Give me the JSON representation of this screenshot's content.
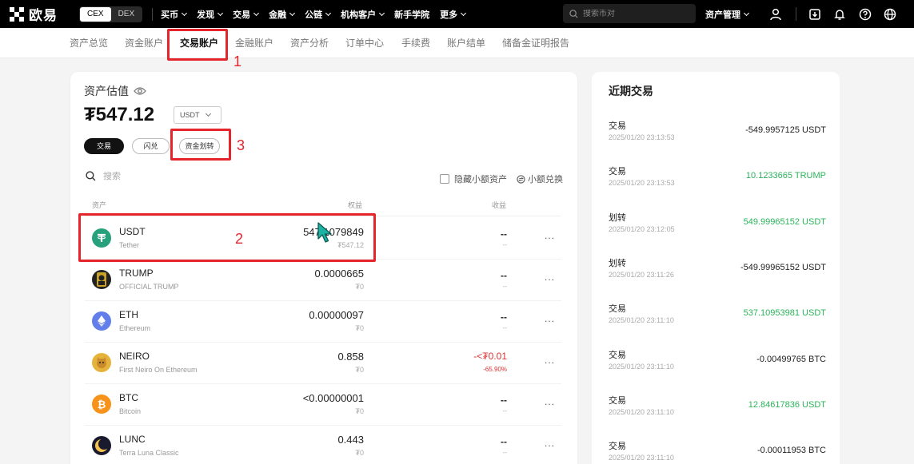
{
  "topbar": {
    "logo_text": "欧易",
    "cex_label": "CEX",
    "dex_label": "DEX",
    "nav": [
      "买币",
      "发现",
      "交易",
      "金融",
      "公链",
      "机构客户",
      "新手学院",
      "更多"
    ],
    "nav_dropdowns": [
      true,
      true,
      true,
      true,
      true,
      true,
      false,
      true
    ],
    "search_placeholder": "搜索币对",
    "asset_mgmt": "资产管理"
  },
  "subnav": {
    "items": [
      "资产总览",
      "资金账户",
      "交易账户",
      "金融账户",
      "资产分析",
      "订单中心",
      "手续费",
      "账户结单",
      "储备金证明报告"
    ],
    "active_index": 2
  },
  "annotations": {
    "n1": "1",
    "n2": "2",
    "n3": "3",
    "color": "#e5242c"
  },
  "account": {
    "est_label": "资产估值",
    "est_value": "₮547.12",
    "currency": "USDT",
    "btn_trade": "交易",
    "btn_flash": "闪兑",
    "btn_transfer": "资金划转",
    "search_placeholder": "搜索",
    "hide_small": "隐藏小额资产",
    "small_convert": "小额兑换",
    "col_asset": "资产",
    "col_equity": "权益",
    "col_pnl": "收益"
  },
  "assets": [
    {
      "symbol": "USDT",
      "name": "Tether",
      "qty": "547.1079849",
      "value": "₮547.12",
      "pnl": "--",
      "pnl_pct": "--",
      "icon": "tether-icon",
      "color": "#26a17b"
    },
    {
      "symbol": "TRUMP",
      "name": "OFFICIAL TRUMP",
      "qty": "0.0000665",
      "value": "₮0",
      "pnl": "--",
      "pnl_pct": "--",
      "icon": "trump-icon",
      "color": "#222222"
    },
    {
      "symbol": "ETH",
      "name": "Ethereum",
      "qty": "0.00000097",
      "value": "₮0",
      "pnl": "--",
      "pnl_pct": "--",
      "icon": "ethereum-icon",
      "color": "#627eea"
    },
    {
      "symbol": "NEIRO",
      "name": "First Neiro On Ethereum",
      "qty": "0.858",
      "value": "₮0",
      "pnl": "-<₮0.01",
      "pnl_pct": "-65.90%",
      "icon": "neiro-icon",
      "color": "#e6b33a"
    },
    {
      "symbol": "BTC",
      "name": "Bitcoin",
      "qty": "<0.00000001",
      "value": "₮0",
      "pnl": "--",
      "pnl_pct": "--",
      "icon": "bitcoin-icon",
      "color": "#f7931a"
    },
    {
      "symbol": "LUNC",
      "name": "Terra Luna Classic",
      "qty": "0.443",
      "value": "₮0",
      "pnl": "--",
      "pnl_pct": "--",
      "icon": "lunc-icon",
      "color": "#1a1a2e"
    }
  ],
  "row_more": "...",
  "recent": {
    "title": "近期交易",
    "items": [
      {
        "type": "交易",
        "time": "2025/01/20 23:13:53",
        "amount": "-549.9957125 USDT",
        "positive": false
      },
      {
        "type": "交易",
        "time": "2025/01/20 23:13:53",
        "amount": "10.1233665 TRUMP",
        "positive": true
      },
      {
        "type": "划转",
        "time": "2025/01/20 23:12:05",
        "amount": "549.99965152 USDT",
        "positive": true
      },
      {
        "type": "划转",
        "time": "2025/01/20 23:11:26",
        "amount": "-549.99965152 USDT",
        "positive": false
      },
      {
        "type": "交易",
        "time": "2025/01/20 23:11:10",
        "amount": "537.10953981 USDT",
        "positive": true
      },
      {
        "type": "交易",
        "time": "2025/01/20 23:11:10",
        "amount": "-0.00499765 BTC",
        "positive": false
      },
      {
        "type": "交易",
        "time": "2025/01/20 23:11:10",
        "amount": "12.84617836 USDT",
        "positive": true
      },
      {
        "type": "交易",
        "time": "2025/01/20 23:11:10",
        "amount": "-0.00011953 BTC",
        "positive": false
      }
    ]
  }
}
